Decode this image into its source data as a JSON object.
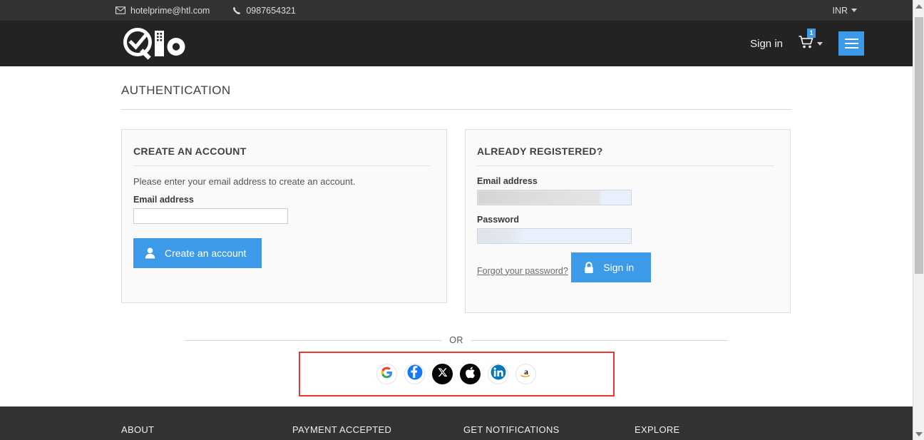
{
  "topbar": {
    "email": "hotelprime@htl.com",
    "phone": "0987654321",
    "currency": "INR",
    "email_icon": "envelope-icon",
    "phone_icon": "phone-icon",
    "caret_icon": "caret-down-icon"
  },
  "header": {
    "logo_alt": "Qlo",
    "signin_label": "Sign in",
    "cart_count": "1",
    "cart_icon": "shopping-cart-icon",
    "menu_icon": "hamburger-menu-icon"
  },
  "main": {
    "page_title": "AUTHENTICATION"
  },
  "create_account": {
    "title": "CREATE AN ACCOUNT",
    "description": "Please enter your email address to create an account.",
    "email_label": "Email address",
    "email_value": "",
    "email_placeholder": "",
    "button_label": "Create an account",
    "button_icon": "user-icon"
  },
  "login": {
    "title": "ALREADY REGISTERED?",
    "email_label": "Email address",
    "email_value": "",
    "password_label": "Password",
    "password_value": "",
    "forgot_label": "Forgot your password?",
    "button_label": "Sign in",
    "button_icon": "lock-icon"
  },
  "divider": {
    "or_label": "OR"
  },
  "social": {
    "providers": [
      {
        "name": "google",
        "icon": "google-icon"
      },
      {
        "name": "facebook",
        "icon": "facebook-icon"
      },
      {
        "name": "x",
        "icon": "x-twitter-icon"
      },
      {
        "name": "apple",
        "icon": "apple-icon"
      },
      {
        "name": "linkedin",
        "icon": "linkedin-icon"
      },
      {
        "name": "amazon",
        "icon": "amazon-icon"
      }
    ],
    "highlight_color": "#f0372f"
  },
  "footer": {
    "columns": [
      {
        "label": "ABOUT"
      },
      {
        "label": "PAYMENT ACCEPTED"
      },
      {
        "label": "GET NOTIFICATIONS"
      },
      {
        "label": "EXPLORE"
      }
    ]
  },
  "colors": {
    "accent": "#3d9ae8",
    "topbar_bg": "#333333",
    "header_bg": "#232323",
    "card_bg": "#fafafa",
    "highlight": "#f0372f"
  }
}
